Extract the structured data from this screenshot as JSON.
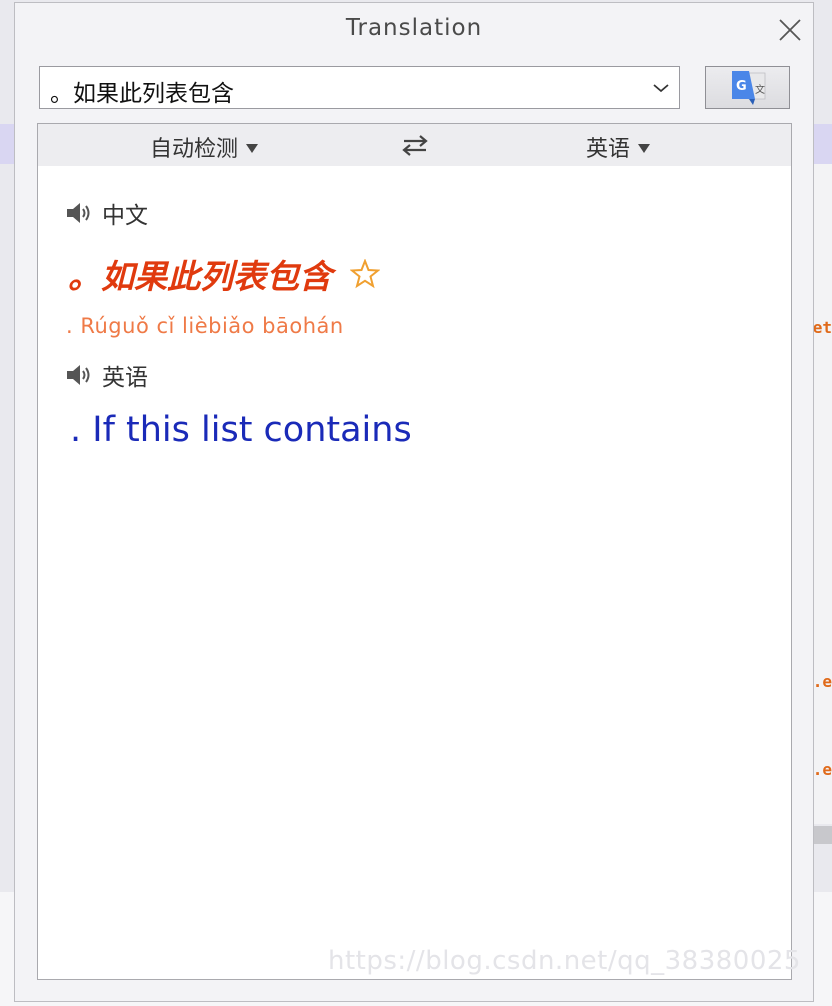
{
  "window": {
    "title": "Translation"
  },
  "input": {
    "value": "。如果此列表包含"
  },
  "languages": {
    "source": "自动检测",
    "target": "英语"
  },
  "result": {
    "source_lang_label": "中文",
    "source_text": "。如果此列表包含",
    "pinyin": ". Rúguǒ cǐ lièbiǎo bāohán",
    "target_lang_label": "英语",
    "target_text": ". If this list contains"
  },
  "watermark": "https://blog.csdn.net/qq_38380025",
  "background": {
    "code_fragments": [
      "et",
      ".e",
      ".e"
    ]
  },
  "colors": {
    "source_text": "#e03a0e",
    "pinyin": "#ef7a47",
    "target_text": "#1a2ab8",
    "star": "#f0a030"
  },
  "icons": {
    "close": "close-icon",
    "dropdown": "chevron-down-icon",
    "translate": "google-translate-icon",
    "swap": "swap-arrows-icon",
    "speaker": "speaker-icon",
    "favorite": "star-icon"
  }
}
